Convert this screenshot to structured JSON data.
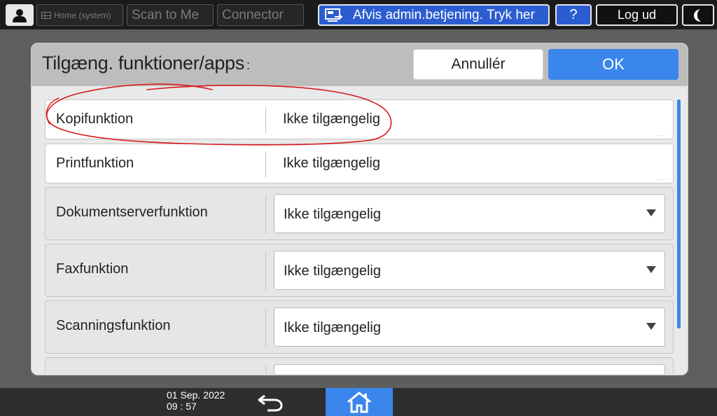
{
  "topbar": {
    "user_icon": "user-icon",
    "home_label": "Home (system)",
    "scan_label": "Scan to Me",
    "connector_label": "Connector",
    "notice_icon": "admin-screen-icon",
    "notice_label": "Afvis admin.betjening. Tryk her",
    "help_label": "?",
    "logout_label": "Log ud",
    "energy_icon": "moon-icon"
  },
  "dialog": {
    "title": "Tilgæng. funktioner/apps",
    "title_suffix": ":",
    "cancel_label": "Annullér",
    "ok_label": "OK",
    "rows": [
      {
        "label": "Kopifunktion",
        "value": "Ikke tilgængelig",
        "type": "static"
      },
      {
        "label": "Printfunktion",
        "value": "Ikke tilgængelig",
        "type": "static"
      },
      {
        "label": "Dokumentserverfunktion",
        "value": "Ikke tilgængelig",
        "type": "select"
      },
      {
        "label": "Faxfunktion",
        "value": "Ikke tilgængelig",
        "type": "select"
      },
      {
        "label": "Scanningsfunktion",
        "value": "Ikke tilgængelig",
        "type": "select"
      }
    ],
    "more_dots": "....",
    "annotation_color": "#d8191d"
  },
  "bottombar": {
    "date": "01 Sep. 2022",
    "time": "09 : 57",
    "back_icon": "back-arrow-icon",
    "home_icon": "home-icon"
  },
  "colors": {
    "accent": "#3b86ec",
    "notice": "#2b5dd0",
    "topbar": "#1b1b1b"
  }
}
